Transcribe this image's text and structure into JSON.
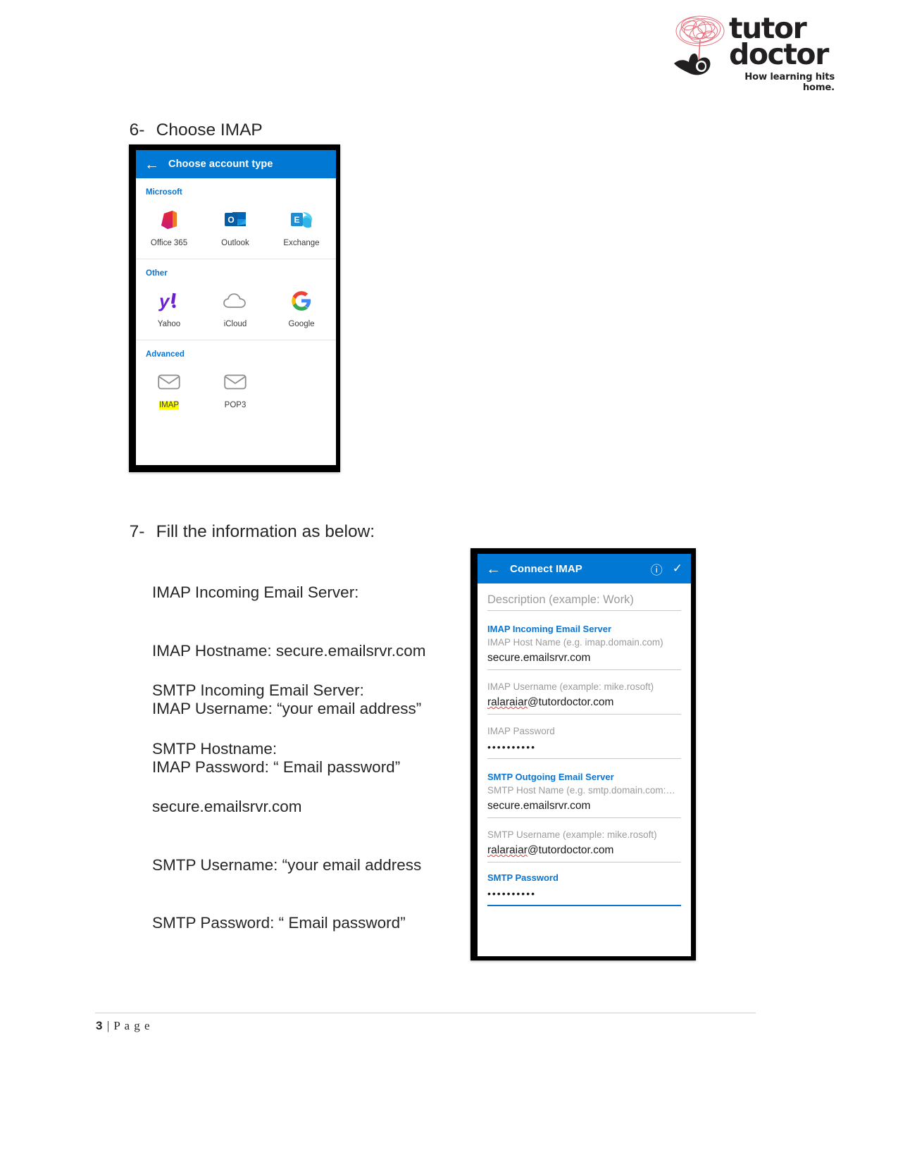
{
  "logo": {
    "line1": "tutor",
    "line2": "doctor",
    "tagline": "How learning hits home.",
    "mark_name": "scribble-brain-hand-logo",
    "accent": "#e8707e",
    "ink": "#211f1f"
  },
  "steps": [
    {
      "number": "6-",
      "text": "Choose IMAP"
    },
    {
      "number": "7-",
      "text": "Fill the information as below:"
    }
  ],
  "instructions": {
    "imap": [
      "IMAP Incoming Email Server:",
      "IMAP Hostname: secure.emailsrvr.com",
      "IMAP Username: “your email address”",
      "IMAP Password: “ Email password”"
    ],
    "smtp": [
      "SMTP Incoming Email Server:",
      "SMTP Hostname:",
      "secure.emailsrvr.com",
      "SMTP Username: “your email address",
      "SMTP Password: “ Email password”"
    ]
  },
  "phone_account_type": {
    "appbar": {
      "back_icon": "arrow-left-icon",
      "title": "Choose account type",
      "bg": "#0078d4"
    },
    "sections": [
      {
        "label": "Microsoft",
        "tiles": [
          {
            "caption": "Office 365",
            "icon": "office365-icon",
            "highlight": false
          },
          {
            "caption": "Outlook",
            "icon": "outlook-icon",
            "highlight": false
          },
          {
            "caption": "Exchange",
            "icon": "exchange-icon",
            "highlight": false
          }
        ]
      },
      {
        "label": "Other",
        "tiles": [
          {
            "caption": "Yahoo",
            "icon": "yahoo-icon",
            "highlight": false
          },
          {
            "caption": "iCloud",
            "icon": "icloud-icon",
            "highlight": false
          },
          {
            "caption": "Google",
            "icon": "google-icon",
            "highlight": false
          }
        ]
      },
      {
        "label": "Advanced",
        "tiles": [
          {
            "caption": "IMAP",
            "icon": "envelope-icon",
            "highlight": true
          },
          {
            "caption": "POP3",
            "icon": "envelope-icon",
            "highlight": false
          }
        ]
      }
    ]
  },
  "phone_connect_imap": {
    "appbar": {
      "back_icon": "arrow-left-icon",
      "title": "Connect IMAP",
      "help_icon": "question-circle-icon",
      "confirm_icon": "check-icon",
      "bg": "#0078d4"
    },
    "description_field": {
      "placeholder": "Description (example: Work)",
      "value": ""
    },
    "imap_group": {
      "heading": "IMAP Incoming Email Server",
      "fields": [
        {
          "label": "IMAP Host Name (e.g. imap.domain.com)",
          "value": "secure.emailsrvr.com",
          "type": "text"
        },
        {
          "label": "IMAP Username (example: mike.rosoft)",
          "value": "ralaraiar@tutordoctor.com",
          "type": "text",
          "misspelled": "ralaraiar"
        },
        {
          "label": "IMAP Password",
          "value": "••••••••••",
          "type": "password"
        }
      ]
    },
    "smtp_group": {
      "heading": "SMTP Outgoing Email Server",
      "fields": [
        {
          "label": "SMTP Host Name (e.g. smtp.domain.com:…",
          "value": "secure.emailsrvr.com",
          "type": "text"
        },
        {
          "label": "SMTP Username (example: mike.rosoft)",
          "value": "ralaraiar@tutordoctor.com",
          "type": "text",
          "misspelled": "ralaraiar"
        },
        {
          "label": "SMTP Password",
          "value": "••••••••••",
          "type": "password"
        }
      ]
    }
  },
  "footer": {
    "page_number": "3",
    "separator": "|",
    "label": "P a g e"
  }
}
